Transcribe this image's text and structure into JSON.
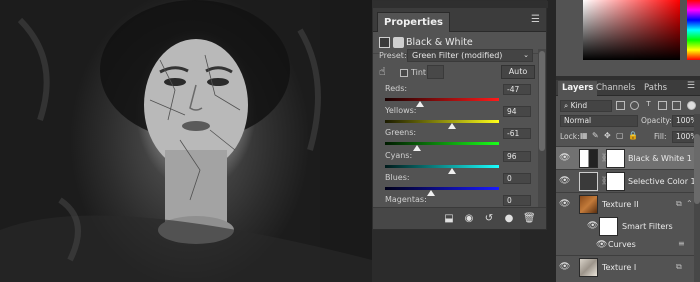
{
  "properties": {
    "tab_label": "Properties",
    "menu_icon": "panel-menu-icon",
    "adjustment_name": "Black & White",
    "preset_label": "Preset:",
    "preset_value": "Green Filter (modified)",
    "tint_label": "Tint",
    "tint_checked": false,
    "auto_label": "Auto",
    "sliders": [
      {
        "label": "Reds:",
        "value": "-47",
        "level": -47,
        "gradient": [
          "#1a0000",
          "#ff1a1a"
        ]
      },
      {
        "label": "Yellows:",
        "value": "94",
        "level": 94,
        "gradient": [
          "#1a1a00",
          "#ffff1a"
        ]
      },
      {
        "label": "Greens:",
        "value": "-61",
        "level": -61,
        "gradient": [
          "#001a00",
          "#1aff1a"
        ]
      },
      {
        "label": "Cyans:",
        "value": "96",
        "level": 96,
        "gradient": [
          "#001a1a",
          "#1affff"
        ]
      },
      {
        "label": "Blues:",
        "value": "0",
        "level": 0,
        "gradient": [
          "#00001a",
          "#1a1aff"
        ]
      },
      {
        "label": "Magentas:",
        "value": "0",
        "level": 0,
        "gradient": [
          "#1a001a",
          "#ff1aff"
        ]
      }
    ],
    "slider_range": [
      -200,
      300
    ],
    "footer_icons": [
      "clip-to-layer-icon",
      "view-previous-icon",
      "reset-icon",
      "visibility-icon",
      "trash-icon"
    ]
  },
  "layers": {
    "tabs": [
      {
        "label": "Layers",
        "active": true
      },
      {
        "label": "Channels",
        "active": false
      },
      {
        "label": "Paths",
        "active": false
      }
    ],
    "filter_kind": "Kind",
    "blend_mode": "Normal",
    "opacity_label": "Opacity:",
    "opacity_value": "100%",
    "lock_label": "Lock:",
    "fill_label": "Fill:",
    "fill_value": "100%",
    "items": [
      {
        "name": "Black & White 1",
        "selected": true,
        "thumb": "bw-adjustment",
        "mask": "white"
      },
      {
        "name": "Selective Color 1",
        "selected": false,
        "thumb": "selective-color-adjustment",
        "mask": "white"
      },
      {
        "name": "Texture II",
        "selected": false,
        "thumb": "rust-texture"
      },
      {
        "name": "Smart Filters",
        "selected": false,
        "thumb": "white-mask",
        "sub": true
      },
      {
        "name": "Curves",
        "selected": false,
        "sub": true,
        "filter": true
      },
      {
        "name": "Texture I",
        "selected": false,
        "thumb": "light-texture"
      }
    ]
  },
  "colors": {
    "panel_bg": "#535353",
    "selected_layer": "#717171",
    "canvas_bg": "#151515"
  }
}
